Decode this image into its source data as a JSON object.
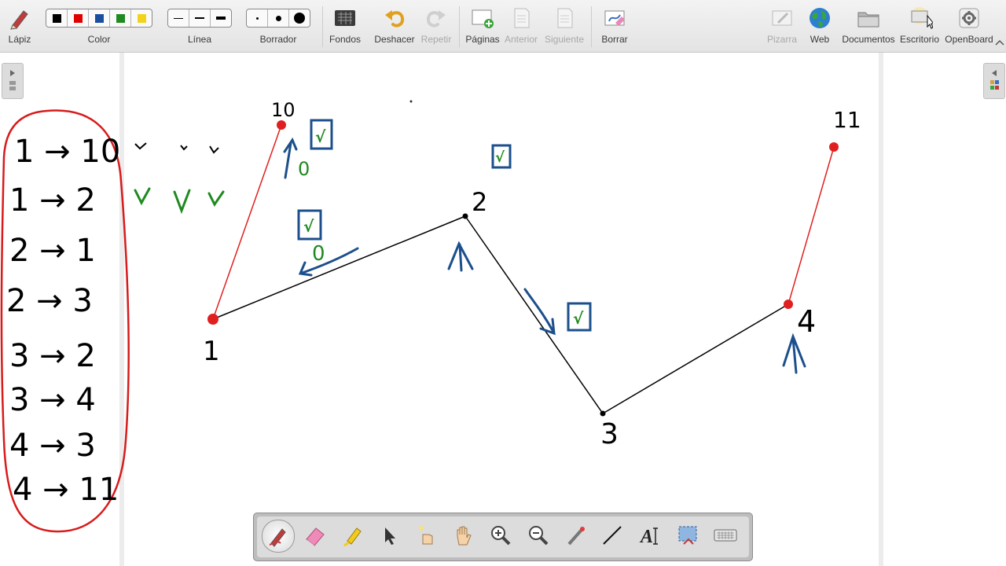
{
  "toolbar": {
    "lapiz": "Lápiz",
    "color": "Color",
    "linea": "Línea",
    "borrador": "Borrador",
    "fondos": "Fondos",
    "deshacer": "Deshacer",
    "repetir": "Repetir",
    "paginas": "Páginas",
    "anterior": "Anterior",
    "siguiente": "Siguiente",
    "borrar": "Borrar",
    "pizarra": "Pizarra",
    "web": "Web",
    "documentos": "Documentos",
    "escritorio": "Escritorio",
    "openboard": "OpenBoard"
  },
  "colors": {
    "swatches": [
      "#000000",
      "#e00000",
      "#1a4fa0",
      "#1f8a1f",
      "#f2d21b"
    ],
    "line_black": "#000000",
    "line_red": "#e02020",
    "ink_blue": "#1c4f8c",
    "ink_green": "#1f8a1f",
    "ink_red_loop": "#d81b1b"
  },
  "notes": {
    "list": [
      "1 → 10",
      "1 → 2",
      "2 → 1",
      "2 → 3",
      "3 → 2",
      "3 → 4",
      "4 → 3",
      "4 → 11"
    ],
    "nodes": {
      "n10": "10",
      "n1": "1",
      "n2": "2",
      "n3": "3",
      "n4": "4",
      "n11": "11"
    },
    "zero_top": "0",
    "zero_mid": "0",
    "check": "√"
  },
  "bottom_tools": [
    "pen-icon",
    "eraser-icon",
    "highlighter-icon",
    "pointer-icon",
    "laser-icon",
    "hand-icon",
    "zoom-in-icon",
    "zoom-out-icon",
    "pointer-pen-icon",
    "line-icon",
    "text-icon",
    "capture-icon",
    "keyboard-icon"
  ]
}
